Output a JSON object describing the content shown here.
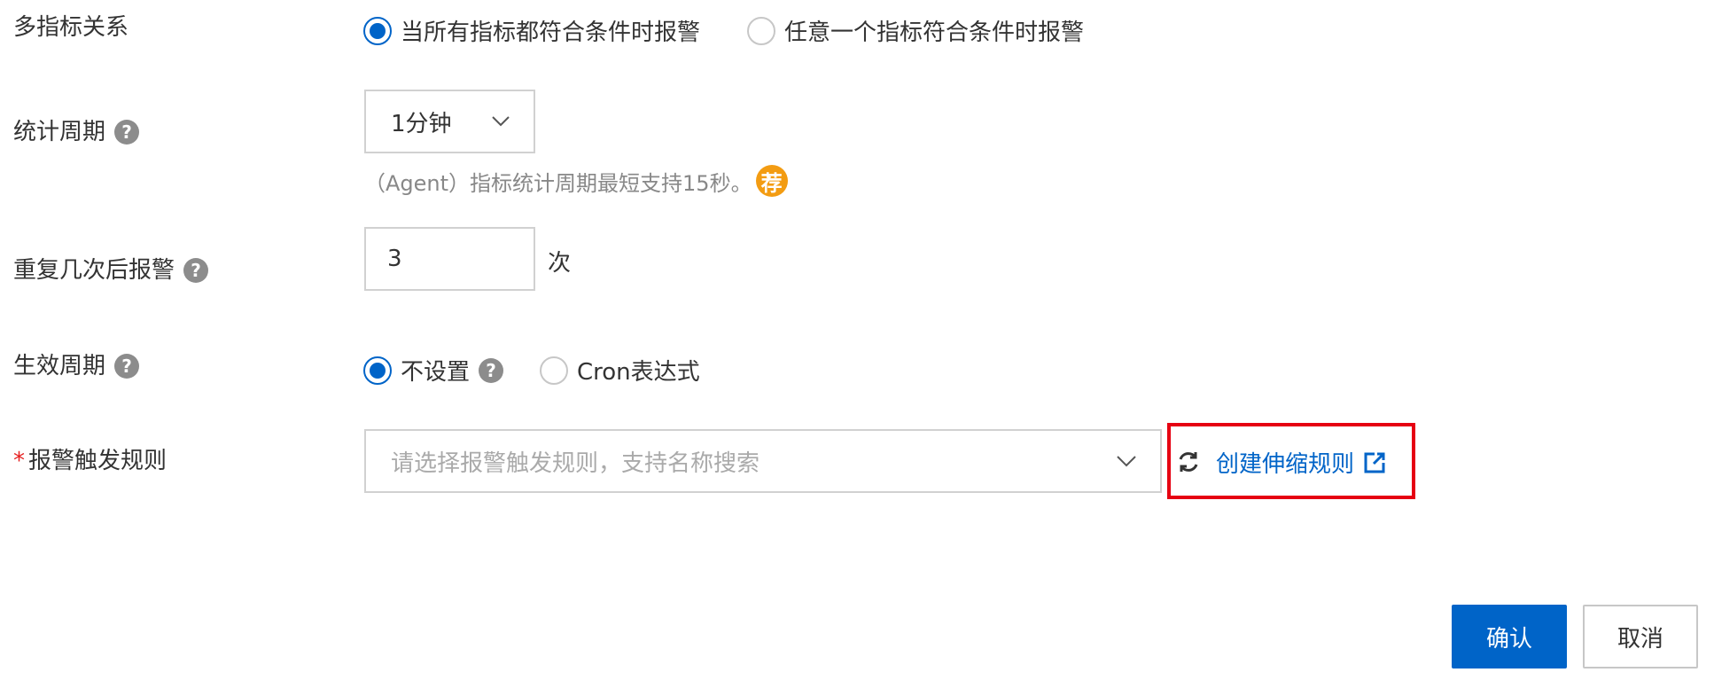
{
  "form": {
    "multi_metric": {
      "label": "多指标关系",
      "options": [
        {
          "label": "当所有指标都符合条件时报警",
          "checked": true
        },
        {
          "label": "任意一个指标符合条件时报警",
          "checked": false
        }
      ]
    },
    "period": {
      "label": "统计周期",
      "help": "?",
      "value": "1分钟",
      "hint": "（Agent）指标统计周期最短支持15秒。",
      "badge": "荐"
    },
    "repeat": {
      "label": "重复几次后报警",
      "help": "?",
      "value": "3",
      "unit": "次"
    },
    "effective": {
      "label": "生效周期",
      "help": "?",
      "options": [
        {
          "label": "不设置",
          "checked": true
        },
        {
          "label": "Cron表达式",
          "checked": false
        }
      ],
      "option_help": "?"
    },
    "trigger_rule": {
      "required_mark": "*",
      "label": "报警触发规则",
      "placeholder": "请选择报警触发规则，支持名称搜索",
      "create_link": "创建伸缩规则"
    }
  },
  "footer": {
    "confirm": "确认",
    "cancel": "取消"
  },
  "colors": {
    "primary": "#0064c8",
    "highlight_border": "#e60012",
    "badge": "#f39c12"
  }
}
